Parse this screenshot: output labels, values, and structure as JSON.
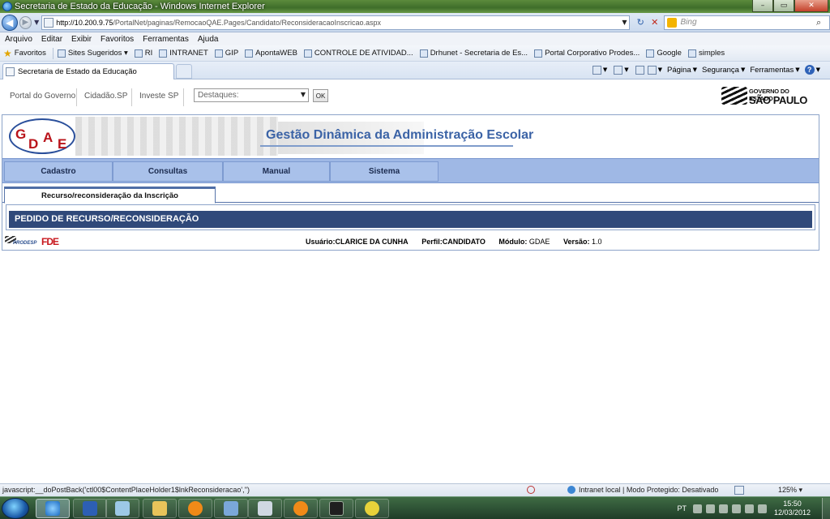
{
  "window": {
    "title": "Secretaria de Estado da Educação - Windows Internet Explorer",
    "minimize": "–",
    "maximize": "▭",
    "close": "✕"
  },
  "addressbar": {
    "back_glyph": "◀",
    "forward_glyph": "▶",
    "url_host": "http://10.200.9.75",
    "url_path": "/PortalNet/paginas/RemocaoQAE.Pages/Candidato/ReconsideracaoInscricao.aspx",
    "refresh_glyph": "↻",
    "stop_glyph": "✕",
    "search_placeholder": "Bing",
    "search_glyph": "⌕"
  },
  "menubar": [
    "Arquivo",
    "Editar",
    "Exibir",
    "Favoritos",
    "Ferramentas",
    "Ajuda"
  ],
  "favorites": {
    "label": "Favoritos",
    "items": [
      "Sites Sugeridos ▾",
      "RI",
      "INTRANET",
      "GIP",
      "ApontaWEB",
      "CONTROLE DE ATIVIDAD...",
      "Drhunet - Secretaria de Es...",
      "Portal Corporativo Prodes...",
      "Google",
      "simples"
    ]
  },
  "browser_tab": {
    "label": "Secretaria de Estado da Educação"
  },
  "commandbar": {
    "pagina": "Página",
    "seguranca": "Segurança",
    "ferramentas": "Ferramentas",
    "help": "?"
  },
  "govbar": {
    "links": [
      "Portal do Governo",
      "Cidadão.SP",
      "Investe SP"
    ],
    "destaques_placeholder": "Destaques:",
    "ok_label": "OK",
    "logo_line1": "GOVERNO DO ESTADO",
    "logo_line2": "SÃO PAULO"
  },
  "gdae": {
    "logo_letters": [
      "G",
      "D",
      "A",
      "E"
    ],
    "title": "Gestão Dinâmica da Administração Escolar"
  },
  "nav_menu": [
    "Cadastro",
    "Consultas",
    "Manual",
    "Sistema"
  ],
  "page_tab": "Recurso/reconsideração da Inscrição",
  "panel_title": "PEDIDO DE RECURSO/RECONSIDERAÇÃO",
  "footer": {
    "prodesp": "PRODESP",
    "fde": "FDE",
    "usuario_label": "Usuário:",
    "usuario_value": "CLARICE DA CUNHA",
    "perfil_label": "Perfil:",
    "perfil_value": "CANDIDATO",
    "modulo_label": "Módulo:",
    "modulo_value": "GDAE",
    "versao_label": "Versão:",
    "versao_value": "1.0"
  },
  "statusbar": {
    "text": "javascript:__doPostBack('ctl00$ContentPlaceHolder1$lnkReconsideracao','')",
    "zone": "Intranet local | Modo Protegido: Desativado",
    "zoom": "125% ▾"
  },
  "taskbar": {
    "lang": "PT",
    "time": "15:50",
    "date": "12/03/2012",
    "apps": [
      "internet-explorer",
      "word",
      "notepad",
      "explorer",
      "app-orange-1",
      "network",
      "calculator",
      "app-orange-2",
      "terminal",
      "game"
    ]
  }
}
